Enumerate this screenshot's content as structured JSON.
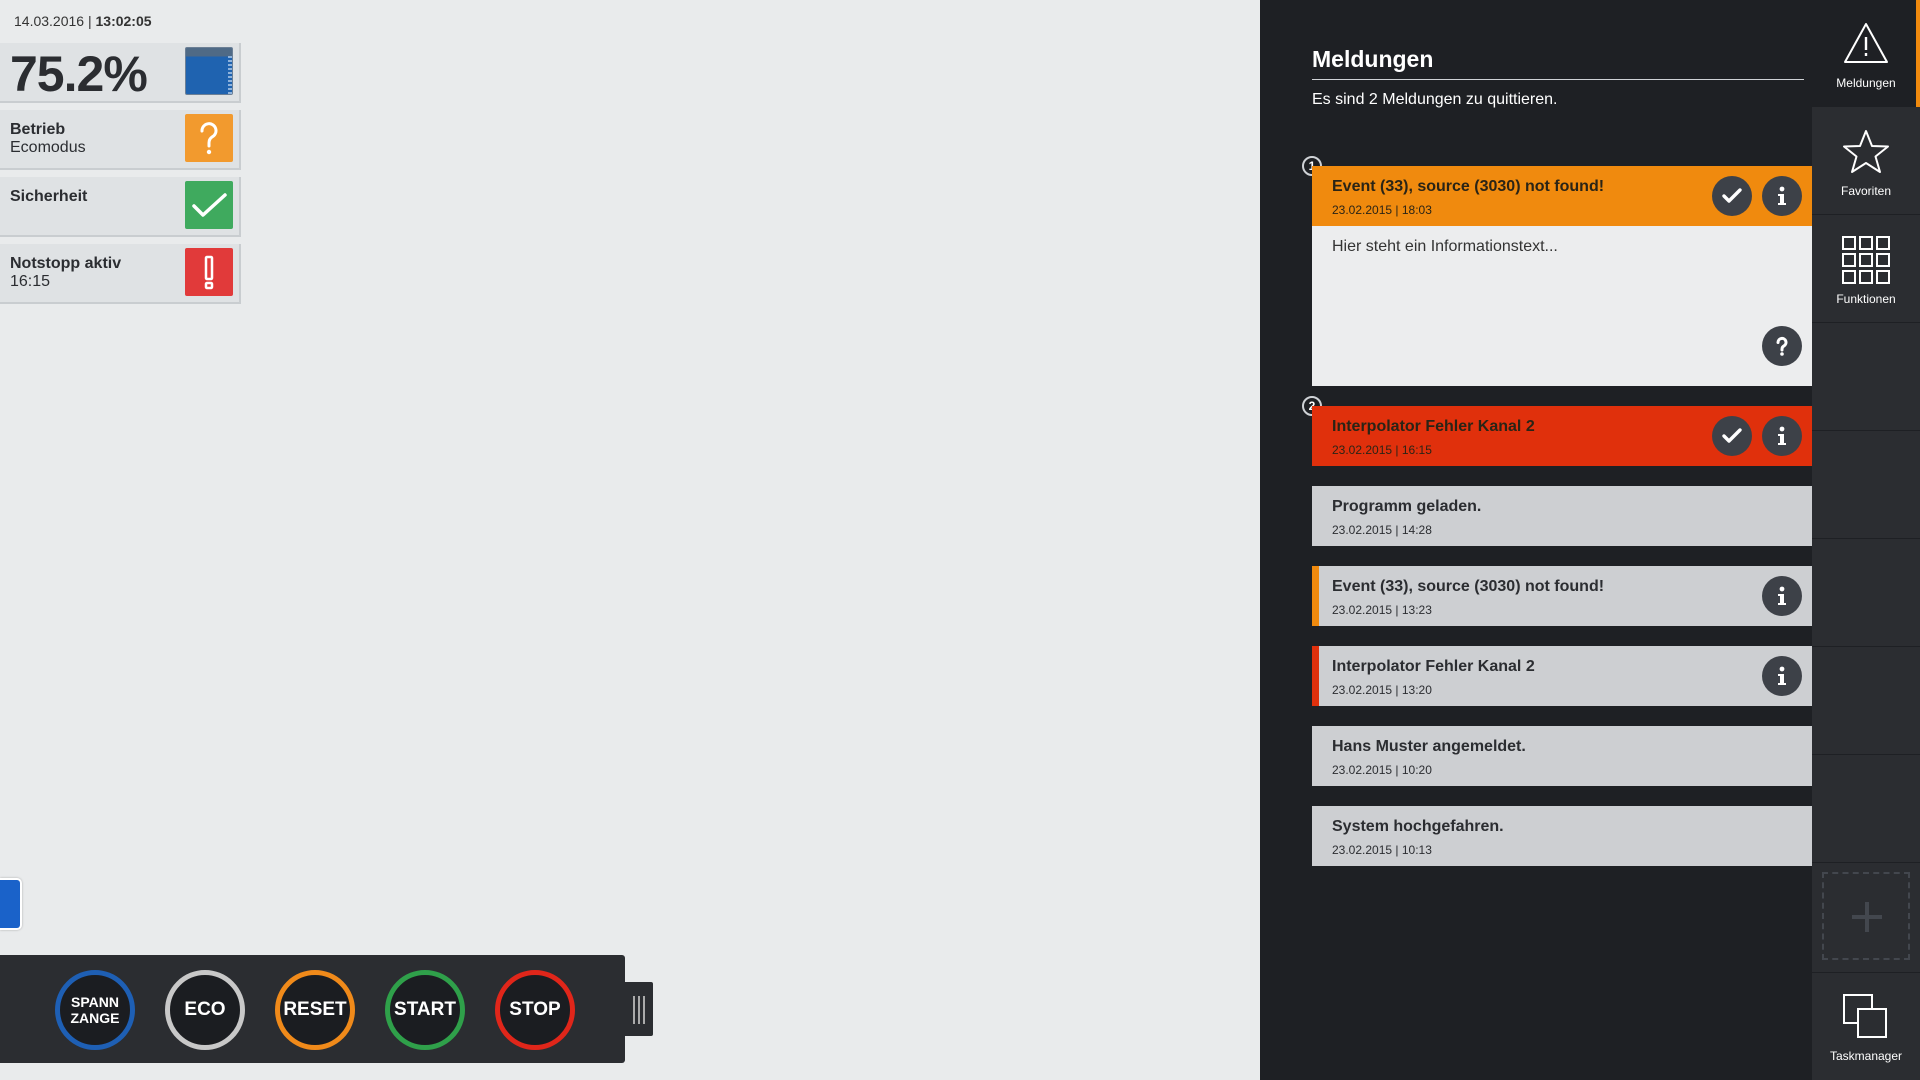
{
  "header": {
    "date": "14.03.2016",
    "separator": " | ",
    "time": "13:02:05"
  },
  "status_tiles": {
    "level": {
      "value": "75.2%",
      "fill_percent": 82,
      "icon": "level-gauge-icon"
    },
    "betrieb": {
      "label": "Betrieb",
      "value": "Ecomodus",
      "icon": "question-icon",
      "color": "#f29a2e"
    },
    "sicherheit": {
      "label": "Sicherheit",
      "icon": "check-icon",
      "color": "#3faa5e"
    },
    "notstopp": {
      "label": "Notstopp aktiv",
      "value": "16:15",
      "icon": "exclamation-icon",
      "color": "#e13a3a"
    }
  },
  "controls": {
    "spannzange_line1": "SPANN",
    "spannzange_line2": "ZANGE",
    "eco": "ECO",
    "reset": "RESET",
    "start": "START",
    "stop": "STOP"
  },
  "panel": {
    "title": "Meldungen",
    "subtitle": "Es sind 2 Meldungen zu quittieren.",
    "messages": [
      {
        "num": "1",
        "title": "Event (33), source (3030) not found!",
        "date": "23.02.2015 | 18:03",
        "detail": "Hier steht ein Informationstext...",
        "color": "#f08a0e"
      },
      {
        "num": "2",
        "title": "Interpolator Fehler Kanal 2",
        "date": "23.02.2015 | 16:15",
        "color": "#e0300c"
      },
      {
        "title": "Programm geladen.",
        "date": "23.02.2015 | 14:28"
      },
      {
        "title": "Event (33), source (3030) not found!",
        "date": "23.02.2015 | 13:23"
      },
      {
        "title": "Interpolator Fehler Kanal 2",
        "date": "23.02.2015 | 13:20"
      },
      {
        "title": "Hans Muster angemeldet.",
        "date": "23.02.2015 | 10:20"
      },
      {
        "title": "System hochgefahren.",
        "date": "23.02.2015 | 10:13"
      }
    ]
  },
  "nav": {
    "meldungen": "Meldungen",
    "favoriten": "Favoriten",
    "funktionen": "Funktionen",
    "taskmanager": "Taskmanager",
    "accent": "#f08a0e"
  }
}
